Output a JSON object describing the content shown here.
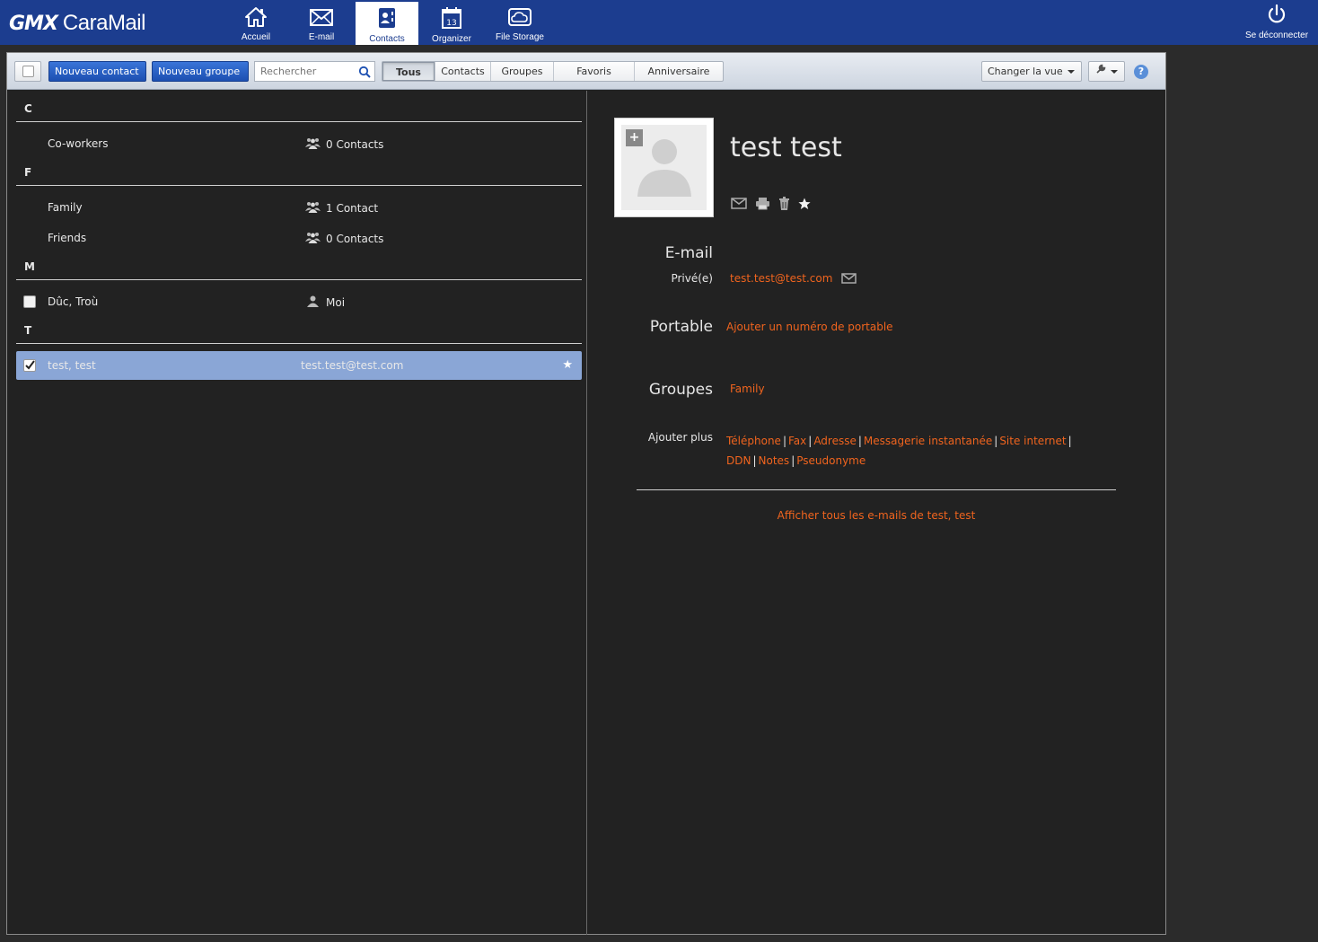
{
  "header": {
    "logo_brand": "GMX",
    "logo_product": "CaraMail",
    "nav": [
      {
        "label": "Accueil",
        "icon": "home-icon"
      },
      {
        "label": "E-mail",
        "icon": "mail-icon"
      },
      {
        "label": "Contacts",
        "icon": "contacts-icon",
        "active": true
      },
      {
        "label": "Organizer",
        "icon": "calendar-icon",
        "day": "13"
      },
      {
        "label": "File Storage",
        "icon": "cloud-icon"
      }
    ],
    "logout_label": "Se déconnecter"
  },
  "toolbar": {
    "new_contact": "Nouveau contact",
    "new_group": "Nouveau groupe",
    "search_placeholder": "Rechercher",
    "tabs": [
      "Tous",
      "Contacts",
      "Groupes",
      "Favoris",
      "Anniversaire"
    ],
    "active_tab": "Tous",
    "change_view": "Changer la vue",
    "help": "?"
  },
  "list": {
    "sections": [
      {
        "letter": "C",
        "items": [
          {
            "name": "Co-workers",
            "info": "0 Contacts",
            "type": "group"
          }
        ]
      },
      {
        "letter": "F",
        "items": [
          {
            "name": "Family",
            "info": "1 Contact",
            "type": "group"
          },
          {
            "name": "Friends",
            "info": "0 Contacts",
            "type": "group"
          }
        ]
      },
      {
        "letter": "M",
        "items": [
          {
            "name": "Dûc, Troù",
            "info": "Moi",
            "type": "me"
          }
        ]
      },
      {
        "letter": "T",
        "items": [
          {
            "name": "test, test",
            "info": "test.test@test.com",
            "type": "contact",
            "selected": true,
            "favorite": true
          }
        ]
      }
    ]
  },
  "detail": {
    "name": "test test",
    "avatar_add": "+",
    "email_heading": "E-mail",
    "email_type": "Privé(e)",
    "email_value": "test.test@test.com",
    "mobile_heading": "Portable",
    "mobile_add": "Ajouter un numéro de portable",
    "groups_heading": "Groupes",
    "groups_value": "Family",
    "add_more_label": "Ajouter plus",
    "add_more_links": [
      "Téléphone",
      "Fax",
      "Adresse",
      "Messagerie instantanée",
      "Site internet",
      "DDN",
      "Notes",
      "Pseudonyme"
    ],
    "show_all_emails": "Afficher tous les e-mails de test, test"
  },
  "colors": {
    "header_blue": "#1c3d8f",
    "link_orange": "#f0641e",
    "selected_row": "#8aa6d6"
  }
}
